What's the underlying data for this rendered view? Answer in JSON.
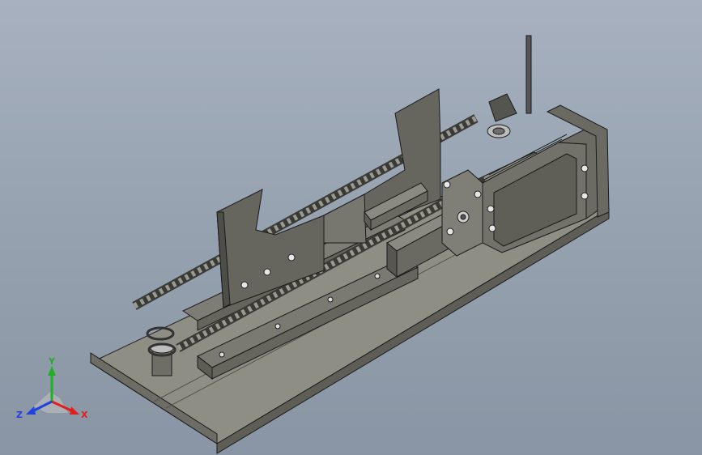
{
  "triad": {
    "x_label": "X",
    "y_label": "Y",
    "z_label": "Z",
    "x_color": "#e02020",
    "y_color": "#22b022",
    "z_color": "#2040e0"
  },
  "model": {
    "base_color": "#8c8c80",
    "body_color": "#6f6f67",
    "edge_color": "#1a1a1a"
  }
}
